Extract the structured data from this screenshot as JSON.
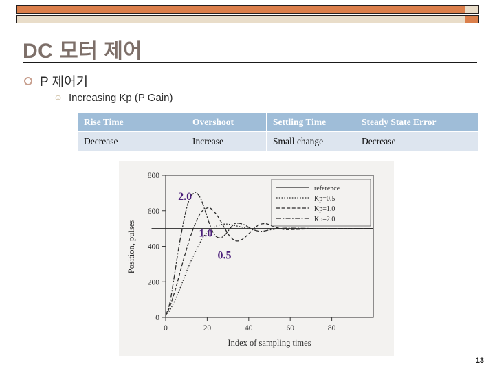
{
  "header": {
    "decoration": {
      "bar_top_color": "#db7f4b",
      "bar_bottom_color": "#e9ddc9",
      "outline_color": "#231f20",
      "cap_top_color": "#e9ddc9",
      "cap_bottom_color": "#db7f4b"
    }
  },
  "slide": {
    "title": "DC 모터 제어",
    "title_color": "#7d6f69",
    "page_number": "13"
  },
  "bullets": {
    "level1": {
      "marker": "hexagon-outline-bullet-icon",
      "text": "P 제어기"
    },
    "level2": {
      "marker": "curl-bullet-icon",
      "glyph": "ɷ",
      "text": "Increasing Kp  (P Gain)"
    }
  },
  "table": {
    "header_bg": "#9fbdd8",
    "body_bg": "#dde5ef",
    "columns": [
      "Rise Time",
      "Overshoot",
      "Settling Time",
      "Steady State Error"
    ],
    "rows": [
      [
        "Decrease",
        "Increase",
        "Small change",
        "Decrease"
      ]
    ]
  },
  "chart_data": {
    "type": "line",
    "title": "",
    "xlabel": "Index of sampling times",
    "ylabel": "Position, pulses",
    "xlim": [
      0,
      100
    ],
    "ylim": [
      0,
      800
    ],
    "xticks": [
      0,
      20,
      40,
      60,
      80
    ],
    "yticks": [
      0,
      200,
      400,
      600,
      800
    ],
    "grid": false,
    "legend_position": "upper right",
    "annotations": [
      {
        "text": "2.0",
        "x": 6,
        "y": 660,
        "color": "#4b1f7a"
      },
      {
        "text": "1.0",
        "x": 16,
        "y": 455,
        "color": "#4b1f7a"
      },
      {
        "text": "0.5",
        "x": 25,
        "y": 330,
        "color": "#4b1f7a"
      }
    ],
    "series": [
      {
        "name": "reference",
        "style": "solid",
        "x": [
          0,
          1,
          100
        ],
        "values": [
          500,
          500,
          500
        ]
      },
      {
        "name": "Kp=0.5",
        "style": "dotted",
        "x": [
          0,
          2,
          5,
          8,
          11,
          14,
          17,
          20,
          23,
          26,
          29,
          32,
          35,
          38,
          41,
          44,
          47,
          50,
          55,
          60,
          70,
          80,
          90,
          100
        ],
        "values": [
          10,
          40,
          110,
          195,
          285,
          360,
          430,
          480,
          505,
          520,
          525,
          520,
          512,
          505,
          500,
          498,
          498,
          499,
          500,
          500,
          500,
          500,
          500,
          500
        ]
      },
      {
        "name": "Kp=1.0",
        "style": "dashed",
        "x": [
          0,
          2,
          5,
          8,
          11,
          14,
          17,
          20,
          22,
          25,
          28,
          31,
          34,
          37,
          40,
          43,
          46,
          49,
          52,
          57,
          62,
          70,
          80,
          90,
          100
        ],
        "values": [
          10,
          60,
          170,
          300,
          420,
          520,
          590,
          615,
          610,
          570,
          510,
          455,
          430,
          440,
          470,
          505,
          525,
          525,
          510,
          495,
          495,
          498,
          500,
          500,
          500
        ]
      },
      {
        "name": "Kp=2.0",
        "style": "dashdot",
        "x": [
          0,
          2,
          4,
          6,
          8,
          10,
          12,
          14,
          15,
          17,
          19,
          21,
          23,
          25,
          27,
          29,
          31,
          33,
          35,
          38,
          41,
          44,
          47,
          50,
          55,
          60,
          70,
          80,
          90,
          100
        ],
        "values": [
          10,
          80,
          220,
          370,
          500,
          610,
          680,
          700,
          700,
          665,
          600,
          530,
          475,
          450,
          450,
          470,
          500,
          525,
          530,
          520,
          500,
          487,
          485,
          492,
          500,
          502,
          500,
          500,
          500,
          500
        ]
      }
    ]
  }
}
